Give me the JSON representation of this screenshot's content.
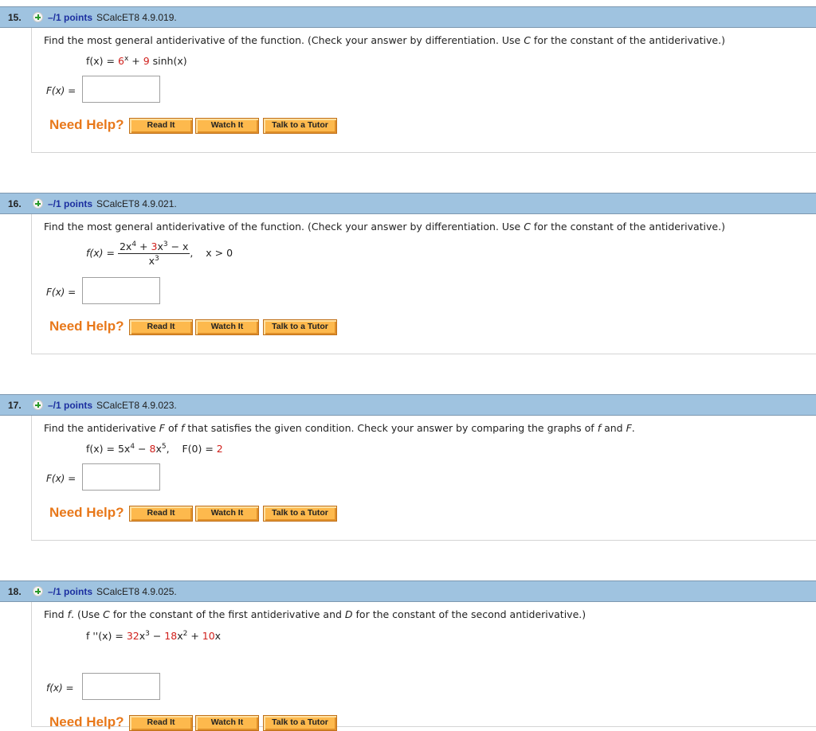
{
  "questions": [
    {
      "number": "15.",
      "points": "–/1 points",
      "code": "SCalcET8 4.9.019.",
      "prompt_parts": [
        "Find the most general antiderivative of the function. (Check your answer by differentiation. Use ",
        "C",
        " for the constant of the antiderivative.)"
      ],
      "formula": {
        "lhs": "f(x) = ",
        "t1": "6",
        "t1_sup": "x",
        "op1": " + ",
        "t2": "9",
        "t2_rest": " sinh(x)"
      },
      "answer_label": "F(x) =",
      "answer_value": "",
      "need_help": "Need Help?",
      "buttons": [
        "Read It",
        "Watch It",
        "Talk to a Tutor"
      ]
    },
    {
      "number": "16.",
      "points": "–/1 points",
      "code": "SCalcET8 4.9.021.",
      "prompt_parts": [
        "Find the most general antiderivative of the function. (Check your answer by differentiation. Use ",
        "C",
        " for the constant of the antiderivative.)"
      ],
      "formula": {
        "lhs": "f(x) = ",
        "num_a": "2x",
        "num_a_sup": "4",
        "num_op1": " + ",
        "num_b": "3",
        "num_b_rest": "x",
        "num_b_sup": "3",
        "num_op2": " − x",
        "den": "x",
        "den_sup": "3",
        "condition": "x > 0"
      },
      "answer_label": "F(x) =",
      "answer_value": "",
      "need_help": "Need Help?",
      "buttons": [
        "Read It",
        "Watch It",
        "Talk to a Tutor"
      ]
    },
    {
      "number": "17.",
      "points": "–/1 points",
      "code": "SCalcET8 4.9.023.",
      "prompt_parts": [
        "Find the antiderivative ",
        "F",
        " of ",
        "f",
        " that satisfies the given condition. Check your answer by comparing the graphs of ",
        "f",
        " and ",
        "F",
        "."
      ],
      "formula": {
        "lhs": "f(x) = ",
        "t1": "5x",
        "t1_sup": "4",
        "op1": " − ",
        "t2": "8",
        "t2_rest": "x",
        "t2_sup": "5",
        "cond_lhs": "F(0) = ",
        "cond_val": "2"
      },
      "answer_label": "F(x) =",
      "answer_value": "",
      "need_help": "Need Help?",
      "buttons": [
        "Read It",
        "Watch It",
        "Talk to a Tutor"
      ]
    },
    {
      "number": "18.",
      "points": "–/1 points",
      "code": "SCalcET8 4.9.025.",
      "prompt_parts": [
        "Find ",
        "f",
        ". (Use ",
        "C",
        " for the constant of the first antiderivative and ",
        "D",
        " for the constant of the second antiderivative.)"
      ],
      "formula": {
        "lhs": "f ''(x) = ",
        "t1": "32",
        "t1_rest": "x",
        "t1_sup": "3",
        "op1": " − ",
        "t2": "18",
        "t2_rest": "x",
        "t2_sup": "2",
        "op2": " + ",
        "t3": "10",
        "t3_rest": "x"
      },
      "answer_label": "f(x) =",
      "answer_value": "",
      "need_help": "Need Help?",
      "buttons": [
        "Read It",
        "Watch It",
        "Talk to a Tutor"
      ]
    }
  ],
  "colors": {
    "header_bg": "#9fc3e0",
    "points": "#1c2fa0",
    "help": "#e8781a",
    "button_bg": "#fdb94d",
    "highlight": "#d0201c"
  }
}
